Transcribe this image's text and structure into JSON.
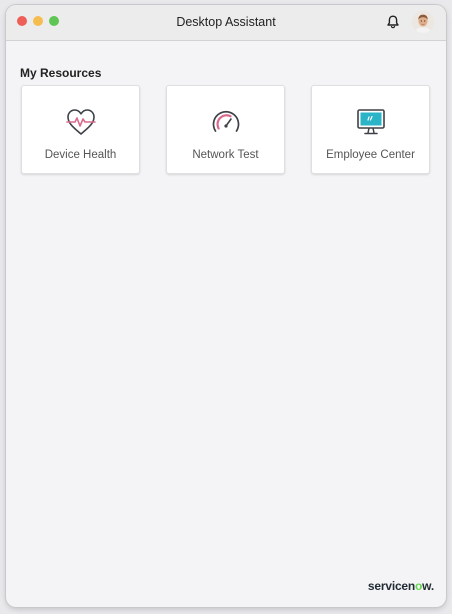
{
  "window": {
    "title": "Desktop Assistant"
  },
  "header": {
    "notification_icon": "bell-icon",
    "avatar": "user-avatar"
  },
  "resources": {
    "section_title": "My Resources",
    "items": [
      {
        "label": "Device Health",
        "icon": "heart-pulse-icon"
      },
      {
        "label": "Network Test",
        "icon": "speedometer-icon"
      },
      {
        "label": "Employee Center",
        "icon": "monitor-icon"
      }
    ]
  },
  "footer": {
    "brand_pre": "servicen",
    "brand_accent": "o",
    "brand_post": "w."
  },
  "colors": {
    "close": "#ee5f57",
    "minimize": "#f5bd4f",
    "zoom": "#5fc553",
    "icon_accent_pink": "#d96a8e",
    "icon_accent_teal": "#2bb3c8",
    "brand_green": "#62d84e"
  }
}
